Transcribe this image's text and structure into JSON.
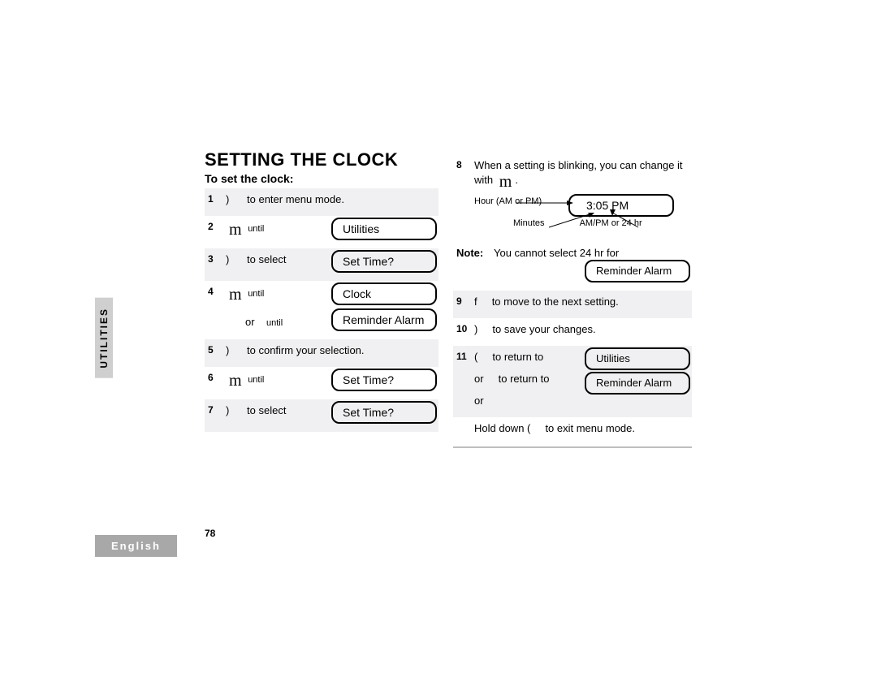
{
  "side": {
    "utilities": "UTILITIES",
    "english": "English"
  },
  "pagenum": "78",
  "title": "SETTING THE CLOCK",
  "subtitle": "To set the clock:",
  "steps": {
    "s1": {
      "n": "1",
      "sym": ")",
      "t": "to enter menu mode."
    },
    "s2": {
      "n": "2",
      "u": "until",
      "lcd": "Utilities"
    },
    "s3": {
      "n": "3",
      "sym": ")",
      "t": "to select",
      "lcd": "Set Time?"
    },
    "s4": {
      "n": "4",
      "u": "until",
      "lcdA": "Clock"
    },
    "s4b": {
      "or": "or",
      "u": "until",
      "lcdB": "Reminder Alarm"
    },
    "s5": {
      "n": "5",
      "sym": ")",
      "t": "to confirm your selection."
    },
    "s6": {
      "n": "6",
      "u": "until",
      "lcd": "Set Time?"
    },
    "s7": {
      "n": "7",
      "sym": ")",
      "t": "to select",
      "lcd": "Set Time?"
    },
    "s8": {
      "n": "8",
      "t": "When a setting is blinking, you can change it",
      "t2": "with"
    },
    "time": {
      "lcd": "3:05 PM",
      "hour": "Hour (AM or PM)",
      "min": "Minutes",
      "ampm": "AM/PM or 24 hr"
    },
    "note": {
      "label": "Note:",
      "t": "You cannot select  24 hr  for",
      "lcd": "Reminder Alarm"
    },
    "s9": {
      "n": "9",
      "sym": "f",
      "t": "to move to the next setting."
    },
    "s10": {
      "n": "10",
      "sym": ")",
      "t": "to save your changes."
    },
    "s11": {
      "n": "11",
      "sym": "(",
      "t": "to return to",
      "lcdA": "Utilities",
      "or": "or",
      "t2": "to return to",
      "lcdB": "Reminder Alarm",
      "or2": "or"
    },
    "hold": {
      "t1": "Hold down (",
      "t2": "to exit menu mode."
    }
  }
}
